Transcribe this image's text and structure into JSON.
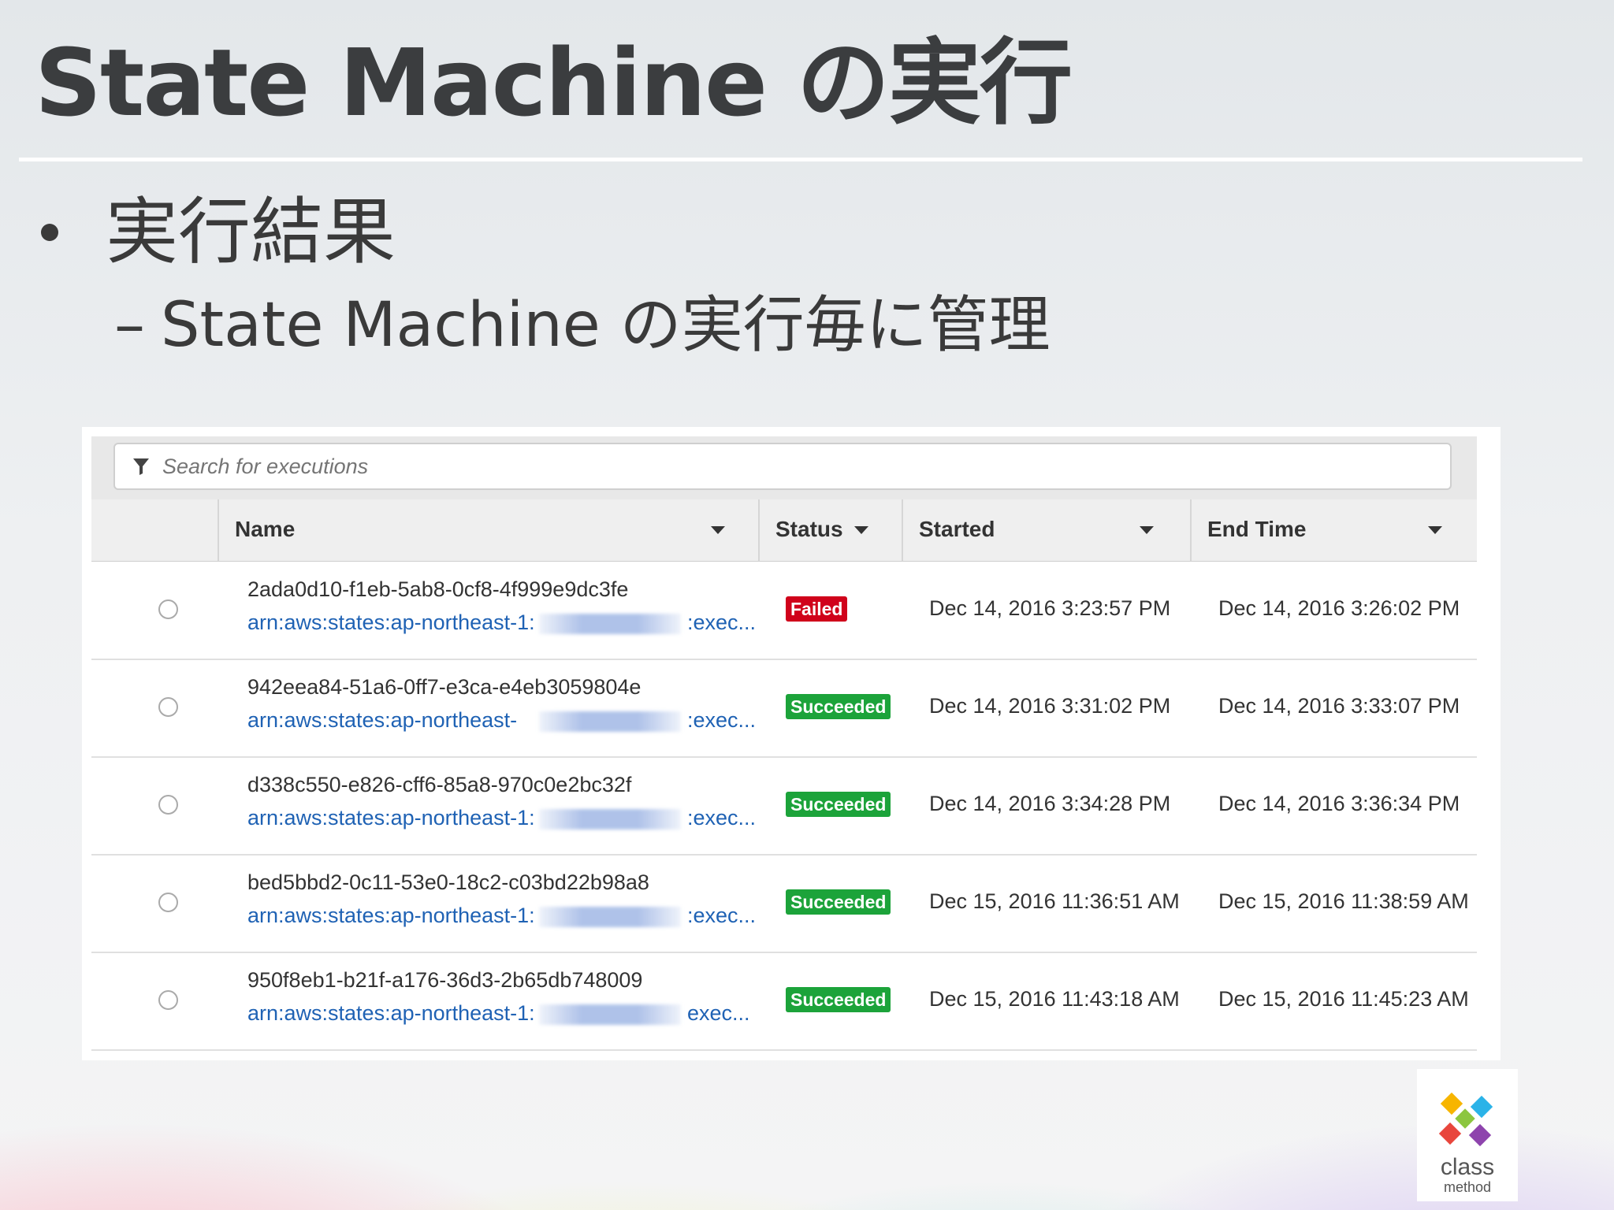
{
  "slide": {
    "title": "State Machine の実行",
    "bullet": "実行結果",
    "subbullet_dash": "–",
    "subbullet": "State Machine の実行毎に管理"
  },
  "console": {
    "search_placeholder": "Search for executions",
    "columns": {
      "name": "Name",
      "status": "Status",
      "started": "Started",
      "end_time": "End Time"
    },
    "rows": [
      {
        "id": "2ada0d10-f1eb-5ab8-0cf8-4f999e9dc3fe",
        "arn_prefix": "arn:aws:states:ap-northeast-1:",
        "arn_suffix": ":exec...",
        "status": "Failed",
        "started": "Dec 14, 2016 3:23:57 PM",
        "end_time": "Dec 14, 2016 3:26:02 PM"
      },
      {
        "id": "942eea84-51a6-0ff7-e3ca-e4eb3059804e",
        "arn_prefix": "arn:aws:states:ap-northeast-",
        "arn_suffix": ":exec...",
        "status": "Succeeded",
        "started": "Dec 14, 2016 3:31:02 PM",
        "end_time": "Dec 14, 2016 3:33:07 PM"
      },
      {
        "id": "d338c550-e826-cff6-85a8-970c0e2bc32f",
        "arn_prefix": "arn:aws:states:ap-northeast-1:",
        "arn_suffix": ":exec...",
        "status": "Succeeded",
        "started": "Dec 14, 2016 3:34:28 PM",
        "end_time": "Dec 14, 2016 3:36:34 PM"
      },
      {
        "id": "bed5bbd2-0c11-53e0-18c2-c03bd22b98a8",
        "arn_prefix": "arn:aws:states:ap-northeast-1:",
        "arn_suffix": ":exec...",
        "status": "Succeeded",
        "started": "Dec 15, 2016 11:36:51 AM",
        "end_time": "Dec 15, 2016 11:38:59 AM"
      },
      {
        "id": "950f8eb1-b21f-a176-36d3-2b65db748009",
        "arn_prefix": "arn:aws:states:ap-northeast-1:",
        "arn_suffix": "exec...",
        "status": "Succeeded",
        "started": "Dec 15, 2016 11:43:18 AM",
        "end_time": "Dec 15, 2016 11:45:23 AM"
      }
    ]
  },
  "logo": {
    "line1": "class",
    "line2": "method",
    "colors": [
      "#f7b500",
      "#2bb3e8",
      "#8cc63f",
      "#e8463c",
      "#8e44ad"
    ]
  }
}
